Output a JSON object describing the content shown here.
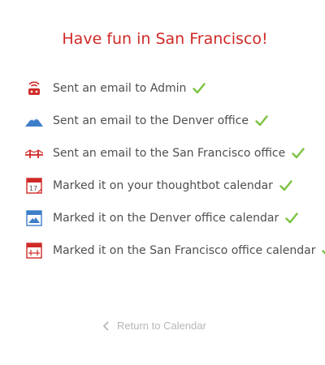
{
  "title": "Have fun in San Francisco!",
  "items": [
    {
      "icon": "router-icon",
      "text": "Sent an email to Admin"
    },
    {
      "icon": "mountain-icon",
      "text": "Sent an email to the Denver office"
    },
    {
      "icon": "bridge-icon",
      "text": "Sent an email to the San Francisco office"
    },
    {
      "icon": "calendar-17-icon",
      "text": "Marked it on your thoughtbot calendar"
    },
    {
      "icon": "calendar-mountain-icon",
      "text": "Marked it on the Denver office calendar"
    },
    {
      "icon": "calendar-bridge-icon",
      "text": "Marked it on the San Francisco office calendar"
    }
  ],
  "return_link": "Return to Calendar",
  "calendar_day": "17",
  "colors": {
    "title": "#cf2a27",
    "check": "#7cc242",
    "icon_red": "#cf2a27",
    "icon_blue": "#3d7ec9",
    "link": "#b7b7b7"
  }
}
